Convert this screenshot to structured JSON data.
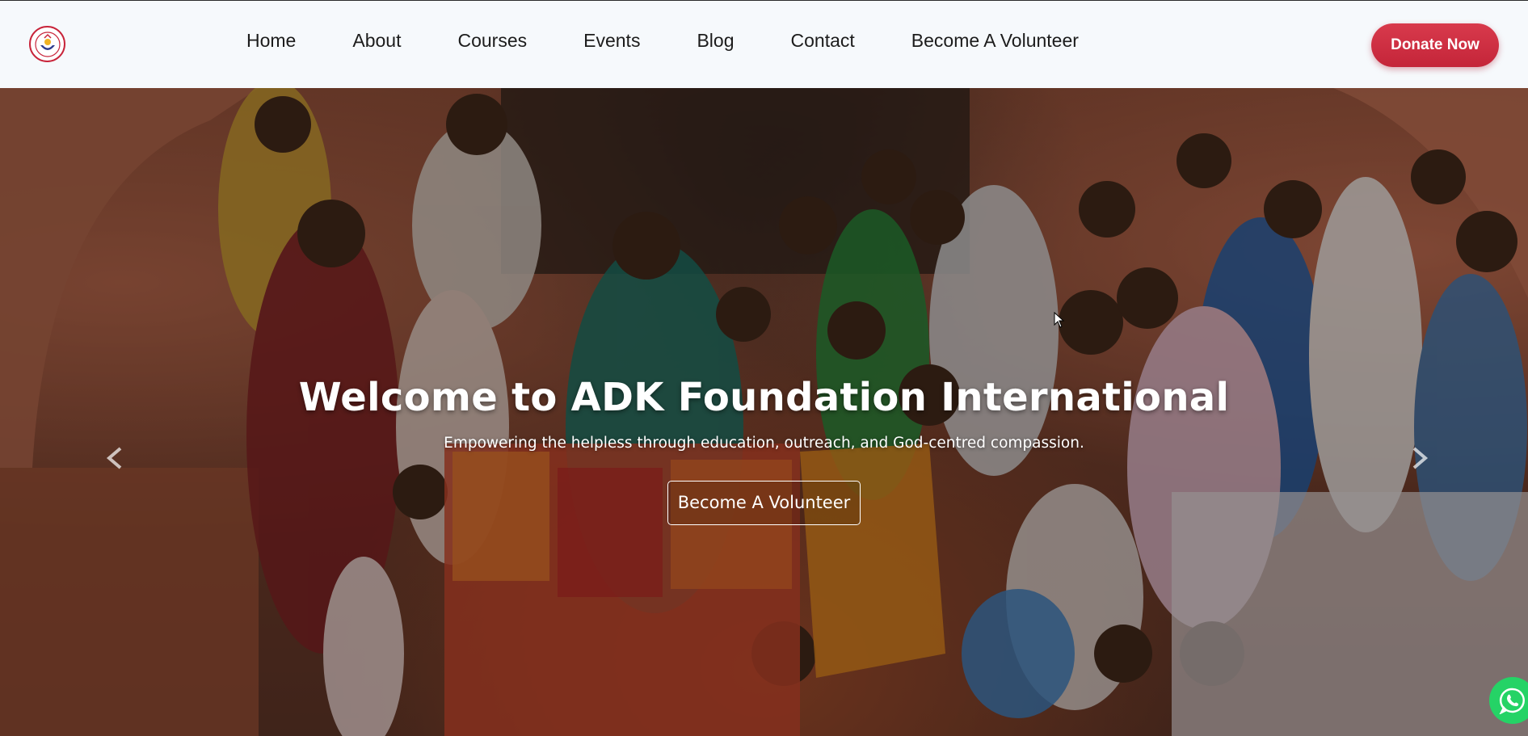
{
  "header": {
    "logo": {
      "icon": "adk-foundation-logo-icon",
      "brand_color": "#c8243a"
    },
    "nav": [
      {
        "label": "Home"
      },
      {
        "label": "About"
      },
      {
        "label": "Courses"
      },
      {
        "label": "Events"
      },
      {
        "label": "Blog"
      },
      {
        "label": "Contact"
      },
      {
        "label": "Become A Volunteer"
      }
    ],
    "donate_label": "Donate Now"
  },
  "hero": {
    "title": "Welcome to ADK Foundation International",
    "subtitle": "Empowering the helpless through education, outreach, and God-centred compassion.",
    "cta_label": "Become A Volunteer",
    "prev_icon": "chevron-left-icon",
    "next_icon": "chevron-right-icon"
  },
  "floating": {
    "whatsapp_icon": "whatsapp-icon",
    "whatsapp_color": "#25d366"
  },
  "colors": {
    "accent": "#c8243a",
    "header_bg": "#f6f9fc",
    "nav_text": "#1c1c1c"
  }
}
